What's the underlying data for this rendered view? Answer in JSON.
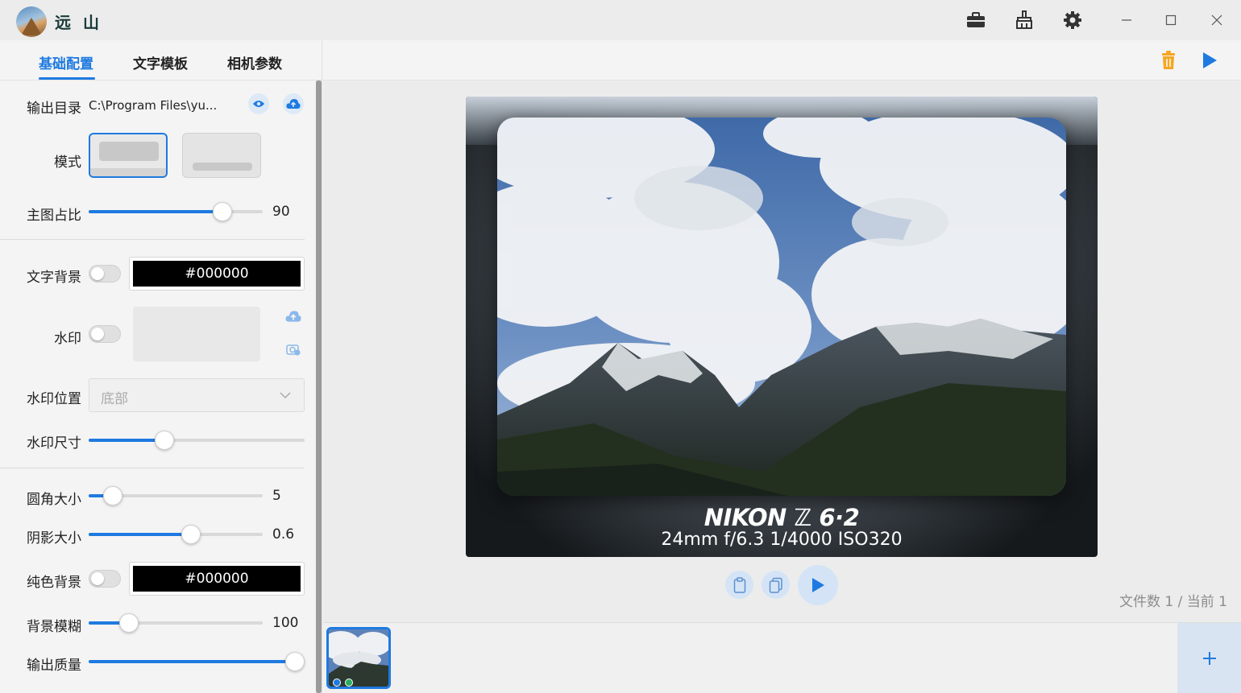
{
  "app": {
    "title": "远 山"
  },
  "tabs": [
    {
      "label": "基础配置"
    },
    {
      "label": "文字模板"
    },
    {
      "label": "相机参数"
    }
  ],
  "settings": {
    "output_dir_label": "输出目录",
    "output_dir_path": "C:\\Program Files\\yu...",
    "mode_label": "模式",
    "main_ratio_label": "主图占比",
    "main_ratio_value": "90",
    "main_ratio_fraction": 0.77,
    "text_bg_label": "文字背景",
    "text_bg_color": "#000000",
    "text_bg_enabled": false,
    "watermark_label": "水印",
    "watermark_enabled": false,
    "watermark_pos_label": "水印位置",
    "watermark_pos_value": "底部",
    "watermark_size_label": "水印尺寸",
    "watermark_size_fraction": 0.35,
    "corner_label": "圆角大小",
    "corner_value": "5",
    "corner_fraction": 0.14,
    "shadow_label": "阴影大小",
    "shadow_value": "0.6",
    "shadow_fraction": 0.59,
    "solid_bg_label": "纯色背景",
    "solid_bg_color": "#000000",
    "solid_bg_enabled": false,
    "blur_label": "背景模糊",
    "blur_value": "100",
    "blur_fraction": 0.23,
    "quality_label": "输出质量",
    "quality_fraction": 1.0
  },
  "preview": {
    "camera_model": "NIKON ℤ 6·2",
    "camera_params": "24mm f/6.3 1/4000 ISO320"
  },
  "status": {
    "file_count": "文件数 1 / 当前 1"
  },
  "colors": {
    "accent": "#1e7ae0",
    "delete": "#f5a623"
  },
  "icons": {
    "toolbox": "toolbox-icon",
    "broom": "broom-icon",
    "settings": "gear-icon",
    "eye": "eye-icon",
    "upload": "cloud-upload-icon",
    "delete": "trash-icon",
    "play": "play-icon",
    "add": "plus-icon"
  }
}
